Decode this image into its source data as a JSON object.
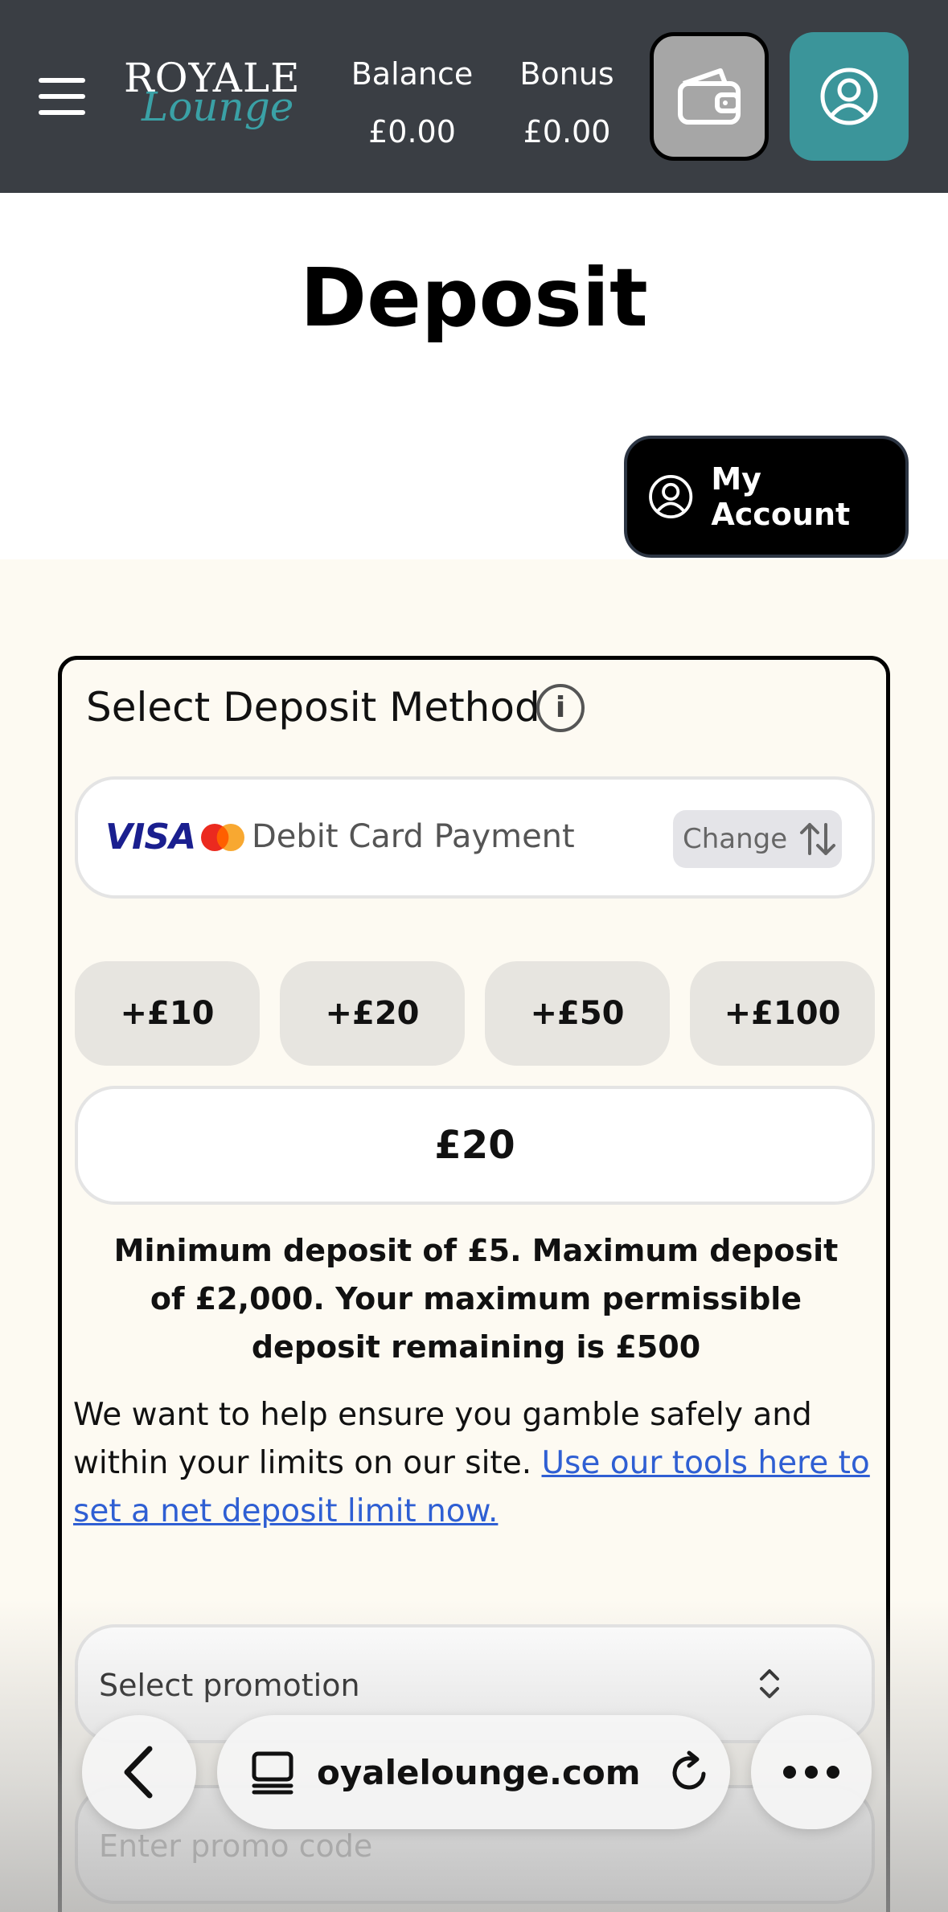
{
  "header": {
    "logo_top": "ROYALE",
    "logo_bottom": "Lounge",
    "balance_label": "Balance",
    "balance_value": "£0.00",
    "bonus_label": "Bonus",
    "bonus_value": "£0.00"
  },
  "page": {
    "title": "Deposit",
    "my_account_label": "My Account"
  },
  "deposit": {
    "section_title": "Select Deposit Method",
    "info_glyph": "i",
    "card_brand": "VISA",
    "method_label": "Debit Card Payment",
    "change_label": "Change",
    "quick_amounts": [
      "+£10",
      "+£20",
      "+£50",
      "+£100"
    ],
    "amount_value": "£20",
    "limits_text": "Minimum deposit of £5. Maximum deposit of £2,000. Your maximum permissible deposit remaining is £500",
    "safe_text": "We want to help ensure you gamble safely and within your limits on our site. ",
    "safe_link": "Use our tools here to set a net deposit limit now.",
    "promo_select_label": "Select promotion",
    "promo_placeholder": "Enter promo code"
  },
  "browser": {
    "url": "oyalelounge.com"
  },
  "icons": {
    "menu": "hamburger-icon",
    "wallet": "wallet-icon",
    "account": "user-circle-icon",
    "info": "info-icon",
    "swap": "swap-vertical-icon",
    "select": "chevron-updown-icon",
    "back": "chevron-left-icon",
    "tabs": "tabs-icon",
    "reload": "reload-icon",
    "more": "more-horizontal-icon"
  },
  "colors": {
    "header_bg": "#3a3e44",
    "teal": "#3b959a",
    "page_bg": "#fdfaf2",
    "link": "#2f5fd3",
    "visa_blue": "#1a1f8f"
  }
}
